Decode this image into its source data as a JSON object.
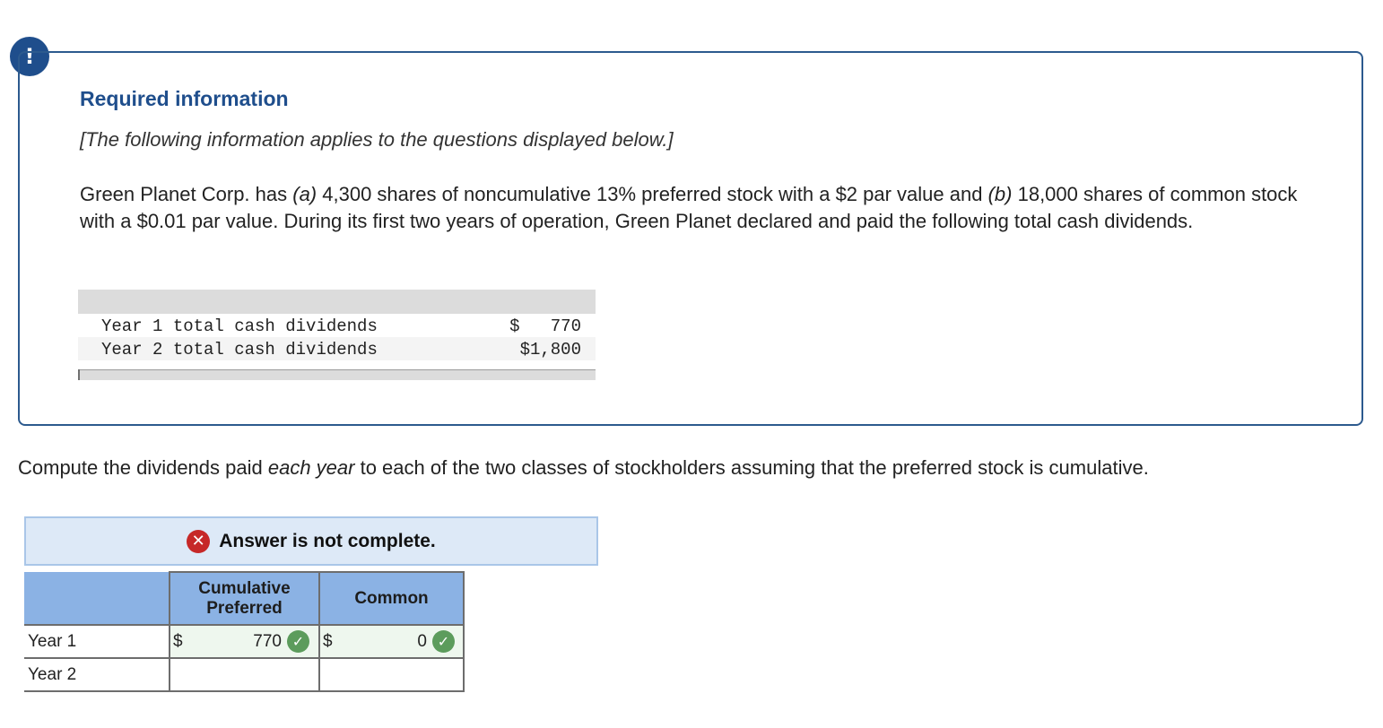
{
  "alert_icon": "exclamation-icon",
  "colors": {
    "accent": "#1f4e8c",
    "header_blue": "#8bb2e4",
    "status_bg": "#dde9f7",
    "error_red": "#c62828",
    "correct_green": "#5c9c5c"
  },
  "info": {
    "title": "Required information",
    "subtitle": "[The following information applies to the questions displayed below.]",
    "paragraph": {
      "p1": "Green Planet Corp. has ",
      "a_marker": "(a)",
      "p2": " 4,300 shares of noncumulative 13% preferred stock with a $2 par value and ",
      "b_marker": "(b)",
      "p3": " 18,000 shares of common stock with a $0.01 par value. During its first two years of operation, Green Planet declared and paid the following total cash dividends."
    },
    "dividends_table": {
      "rows": [
        {
          "label": "Year 1 total cash dividends",
          "amount": "$   770"
        },
        {
          "label": "Year 2 total cash dividends",
          "amount": "$1,800"
        }
      ]
    }
  },
  "question": {
    "pre": "Compute the dividends paid ",
    "emph": "each year",
    "post": " to each of the two classes of stockholders assuming that the preferred stock is cumulative."
  },
  "status": {
    "icon": "x-icon",
    "text": "Answer is not complete."
  },
  "answer_table": {
    "headers": {
      "label": "",
      "preferred": "Cumulative\nPreferred",
      "common": "Common"
    },
    "rows": [
      {
        "label": "Year 1",
        "preferred_currency": "$",
        "preferred_value": "770",
        "preferred_status": "check-icon",
        "common_currency": "$",
        "common_value": "0",
        "common_status": "check-icon"
      },
      {
        "label": "Year 2",
        "preferred_currency": "",
        "preferred_value": "",
        "common_currency": "",
        "common_value": ""
      }
    ]
  }
}
